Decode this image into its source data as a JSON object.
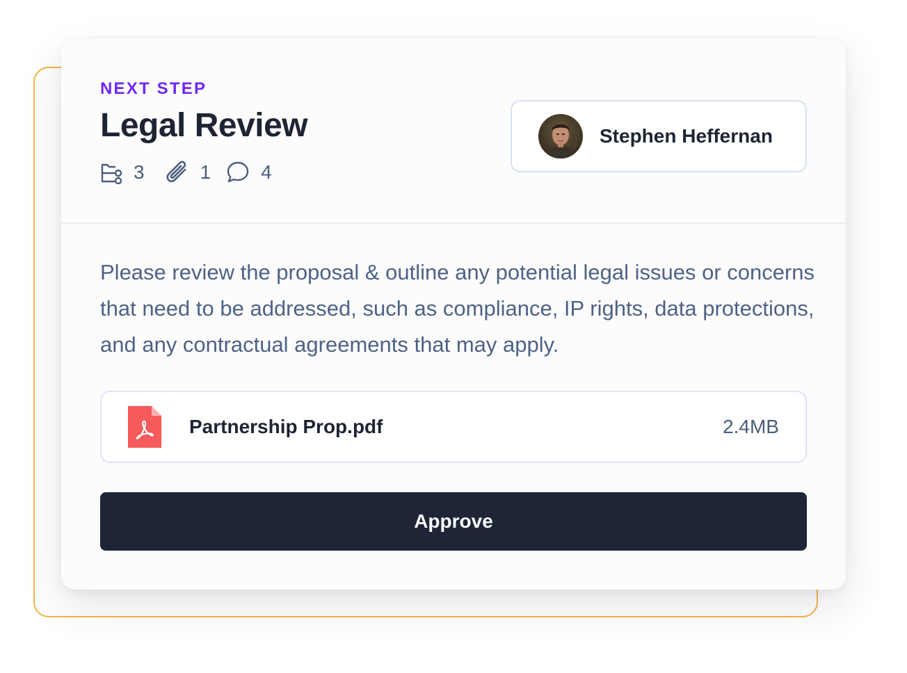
{
  "card": {
    "eyebrow": "NEXT STEP",
    "title": "Legal Review",
    "meta": {
      "subtasks": {
        "icon": "subtasks-icon",
        "count": "3"
      },
      "attachments": {
        "icon": "paperclip-icon",
        "count": "1"
      },
      "comments": {
        "icon": "comment-icon",
        "count": "4"
      }
    },
    "assignee": {
      "name": "Stephen Heffernan",
      "avatar": "avatar-photo"
    },
    "description": "Please review the proposal & outline any potential legal issues or concerns that need to be addressed, such as compliance, IP rights, data protections, and any contractual agreements that may apply.",
    "attachment": {
      "icon": "pdf-file-icon",
      "name": "Partnership Prop.pdf",
      "size": "2.4MB"
    },
    "approve_label": "Approve"
  },
  "colors": {
    "accent": "#6d28f5",
    "frame": "#f3b548",
    "button": "#1d2537",
    "pdf": "#f65a5a"
  }
}
